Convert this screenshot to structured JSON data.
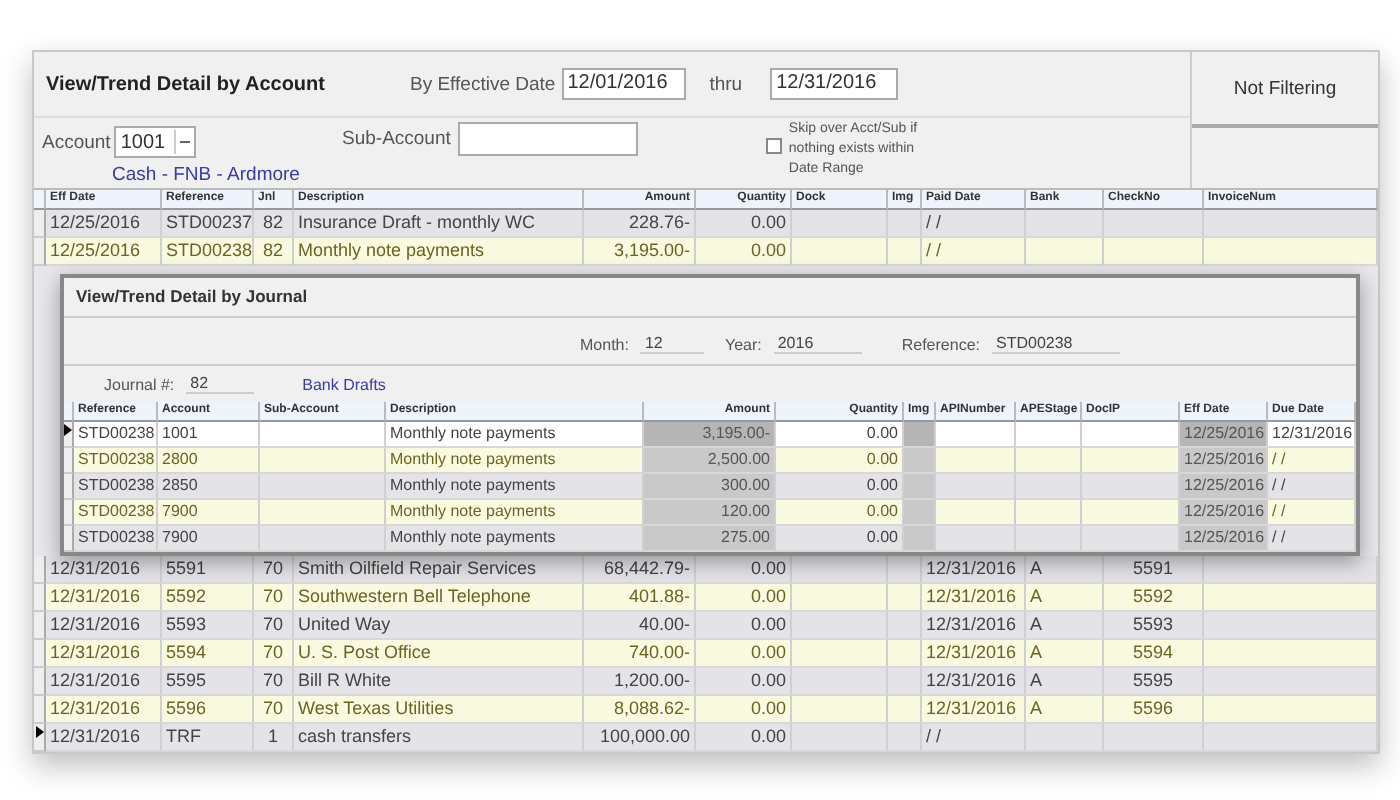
{
  "window": {
    "title": "View/Trend Detail by Account"
  },
  "filters": {
    "effective_date_label": "By Effective Date",
    "from": "12/01/2016",
    "thru_label": "thru",
    "thru": "12/31/2016",
    "account_label": "Account",
    "account": "1001",
    "account_name": "Cash - FNB - Ardmore",
    "sub_account_label": "Sub-Account",
    "skip_option": {
      "label": "Skip over Acct/Sub if nothing exists within Date Range",
      "checked": false
    },
    "filter_status": "Not Filtering"
  },
  "grid": {
    "columns": [
      "Eff Date",
      "Reference",
      "Jnl",
      "Description",
      "Amount",
      "Quantity",
      "Dock",
      "Img",
      "Paid Date",
      "Bank",
      "CheckNo",
      "InvoiceNum"
    ],
    "rows": [
      {
        "current": false,
        "cells": [
          "12/25/2016",
          "STD00237",
          "82",
          "Insurance Draft - monthly WC",
          "228.76-",
          "0.00",
          null,
          null,
          "/ /",
          null,
          null,
          null
        ]
      },
      {
        "current": false,
        "cells": [
          "12/25/2016",
          "STD00238",
          "82",
          "Monthly note payments",
          "3,195.00-",
          "0.00",
          null,
          null,
          "/ /",
          null,
          null,
          null
        ]
      }
    ],
    "rows_after": [
      {
        "current": false,
        "cells": [
          "12/31/2016",
          "5591",
          "70",
          "Smith Oilfield Repair Services",
          "68,442.79-",
          "0.00",
          null,
          null,
          "12/31/2016",
          "A",
          "5591",
          null
        ]
      },
      {
        "current": false,
        "cells": [
          "12/31/2016",
          "5592",
          "70",
          "Southwestern Bell Telephone",
          "401.88-",
          "0.00",
          null,
          null,
          "12/31/2016",
          "A",
          "5592",
          null
        ]
      },
      {
        "current": false,
        "cells": [
          "12/31/2016",
          "5593",
          "70",
          "United Way",
          "40.00-",
          "0.00",
          null,
          null,
          "12/31/2016",
          "A",
          "5593",
          null
        ]
      },
      {
        "current": false,
        "cells": [
          "12/31/2016",
          "5594",
          "70",
          "U. S. Post Office",
          "740.00-",
          "0.00",
          null,
          null,
          "12/31/2016",
          "A",
          "5594",
          null
        ]
      },
      {
        "current": false,
        "cells": [
          "12/31/2016",
          "5595",
          "70",
          "Bill R White",
          "1,200.00-",
          "0.00",
          null,
          null,
          "12/31/2016",
          "A",
          "5595",
          null
        ]
      },
      {
        "current": false,
        "cells": [
          "12/31/2016",
          "5596",
          "70",
          "West Texas Utilities",
          "8,088.62-",
          "0.00",
          null,
          null,
          "12/31/2016",
          "A",
          "5596",
          null
        ]
      },
      {
        "current": true,
        "cells": [
          "12/31/2016",
          "TRF",
          "1",
          "cash transfers",
          "100,000.00",
          "0.00",
          null,
          null,
          "/ /",
          null,
          null,
          null
        ]
      }
    ]
  },
  "dialog": {
    "title": "View/Trend Detail by Journal",
    "month_label": "Month:",
    "month": "12",
    "year_label": "Year:",
    "year": "2016",
    "reference_label": "Reference:",
    "reference": "STD00238",
    "journal_label": "Journal #:",
    "journal": "82",
    "journal_name": "Bank Drafts",
    "columns": [
      "Reference",
      "Account",
      "Sub-Account",
      "Description",
      "Amount",
      "Quantity",
      "Img",
      "APINumber",
      "APEStage",
      "DocIP",
      "Eff Date",
      "Due Date"
    ],
    "rows": [
      {
        "current": true,
        "cells": [
          "STD00238",
          "1001",
          null,
          "Monthly note payments",
          "3,195.00-",
          "0.00",
          null,
          null,
          null,
          null,
          "12/25/2016",
          "12/31/2016"
        ]
      },
      {
        "current": false,
        "cells": [
          "STD00238",
          "2800",
          null,
          "Monthly note payments",
          "2,500.00",
          "0.00",
          null,
          null,
          null,
          null,
          "12/25/2016",
          "/ /"
        ]
      },
      {
        "current": false,
        "cells": [
          "STD00238",
          "2850",
          null,
          "Monthly note payments",
          "300.00",
          "0.00",
          null,
          null,
          null,
          null,
          "12/25/2016",
          "/ /"
        ]
      },
      {
        "current": false,
        "cells": [
          "STD00238",
          "7900",
          null,
          "Monthly note payments",
          "120.00",
          "0.00",
          null,
          null,
          null,
          null,
          "12/25/2016",
          "/ /"
        ]
      },
      {
        "current": false,
        "cells": [
          "STD00238",
          "7900",
          null,
          "Monthly note payments",
          "275.00",
          "0.00",
          null,
          null,
          null,
          null,
          "12/25/2016",
          "/ /"
        ]
      }
    ]
  }
}
